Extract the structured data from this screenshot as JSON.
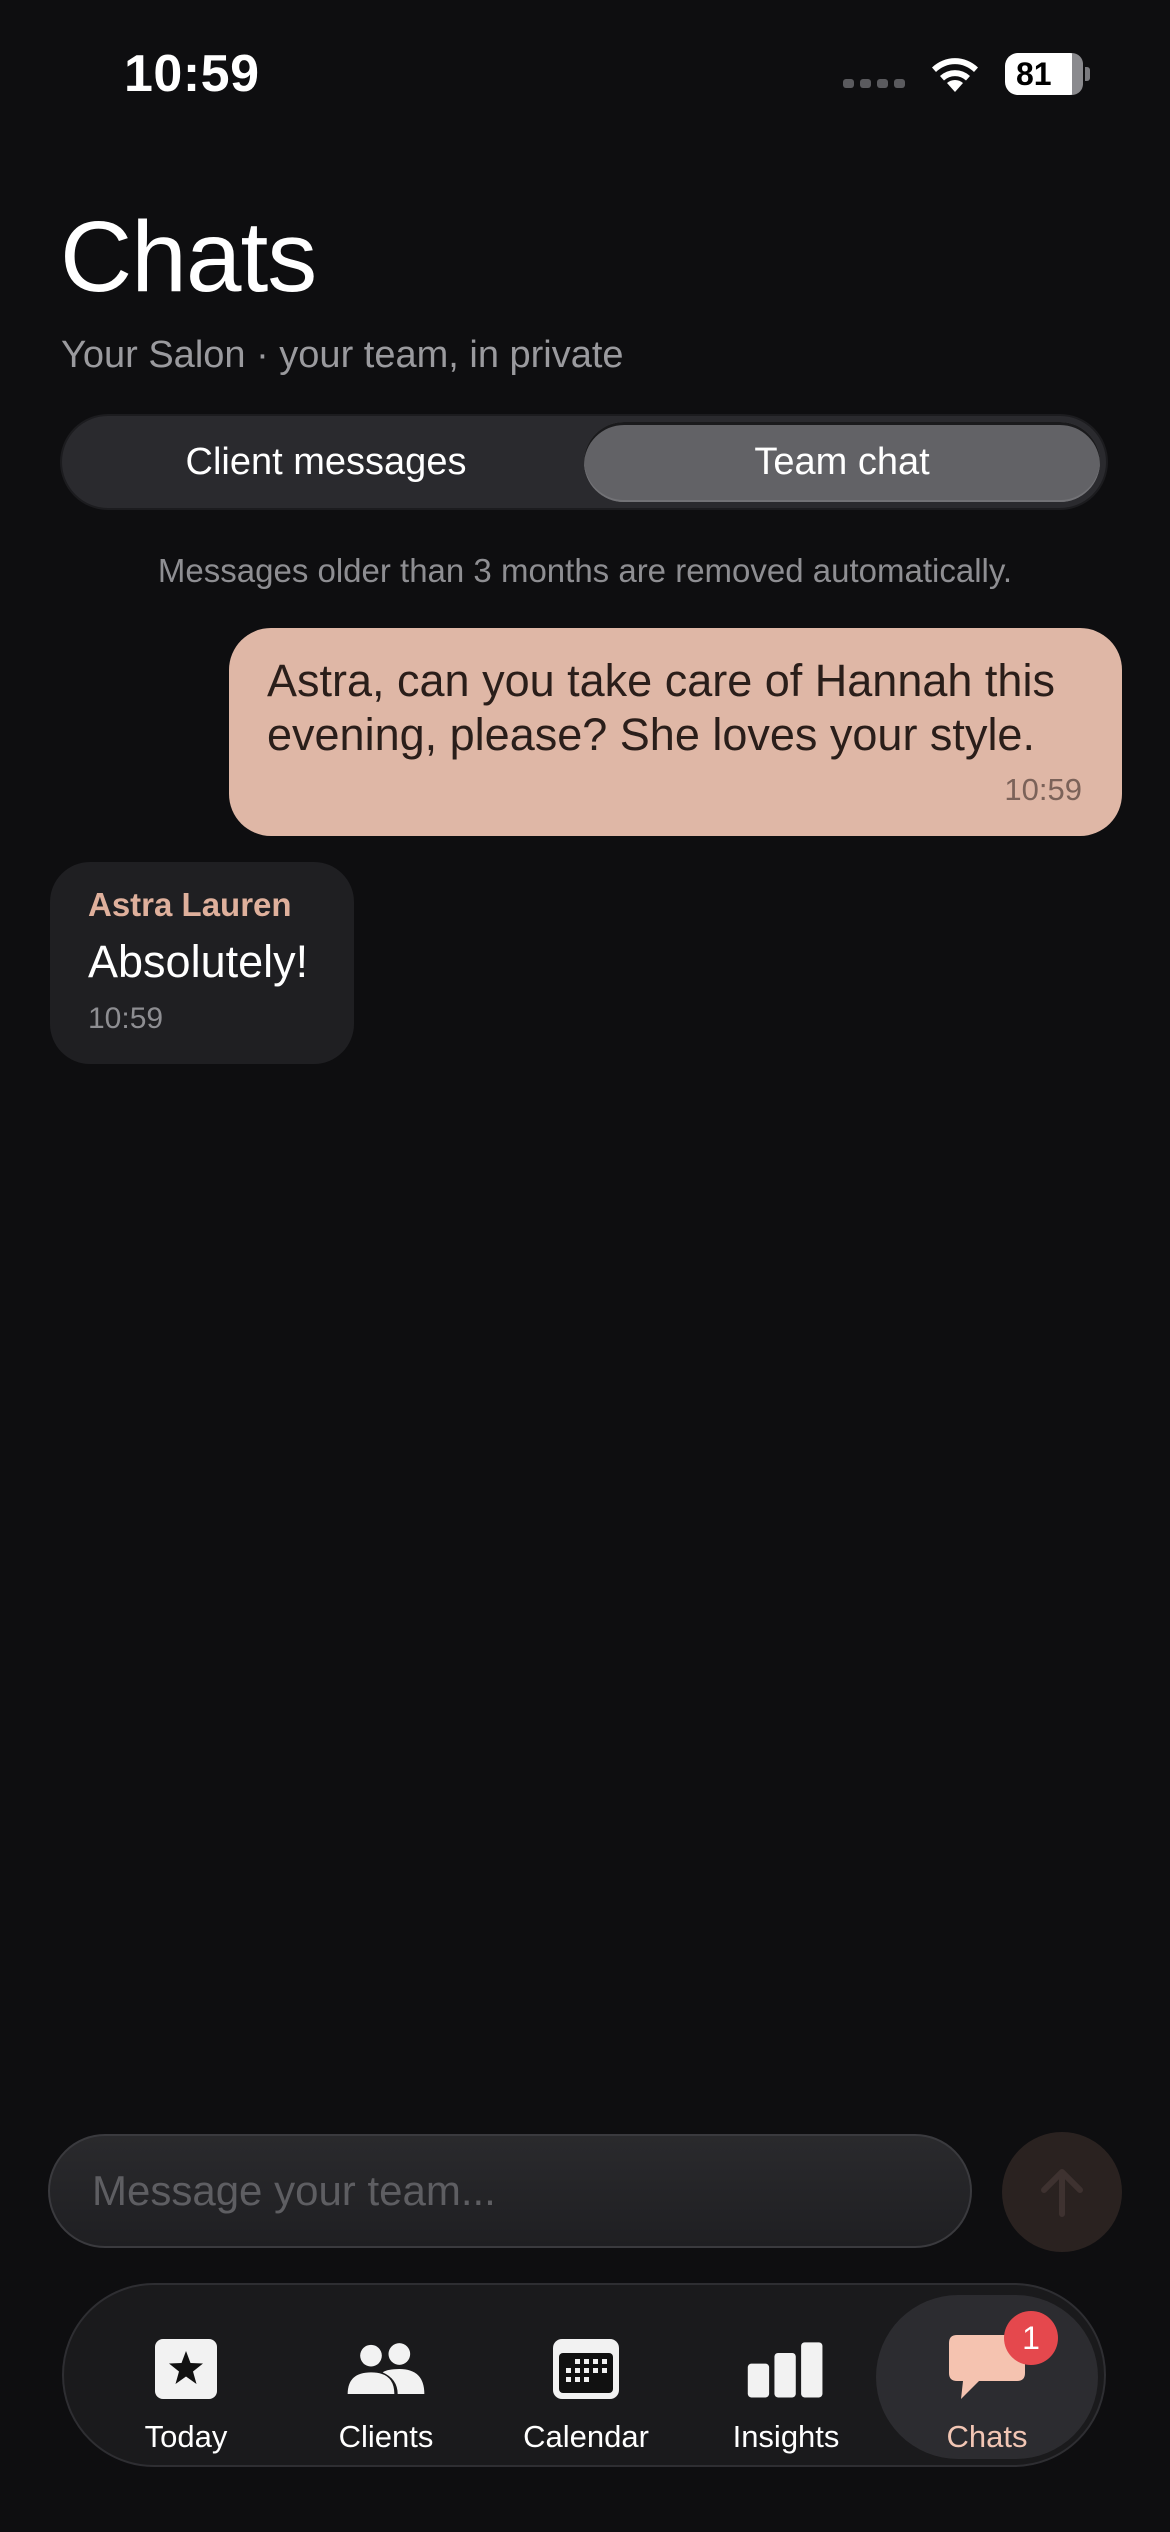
{
  "status_bar": {
    "time": "10:59",
    "battery": "81",
    "icons": [
      "signal-dots-icon",
      "wifi-icon",
      "battery-icon"
    ]
  },
  "header": {
    "title": "Chats",
    "subtitle": "Your Salon · your team, in private"
  },
  "segments": {
    "client_messages": "Client messages",
    "team_chat": "Team chat",
    "selected": "Team chat"
  },
  "retention_note": "Messages older than 3 months are removed automatically.",
  "messages": [
    {
      "direction": "outgoing",
      "text": "Astra, can you take care of Hannah this evening, please? She loves your style.",
      "time": "10:59"
    },
    {
      "direction": "incoming",
      "sender": "Astra Lauren",
      "text": "Absolutely!",
      "time": "10:59"
    }
  ],
  "composer": {
    "placeholder": "Message your team...",
    "value": "",
    "send_icon": "arrow-up-icon"
  },
  "tabbar": {
    "tabs": [
      {
        "label": "Today",
        "icon": "star-icon"
      },
      {
        "label": "Clients",
        "icon": "people-icon"
      },
      {
        "label": "Calendar",
        "icon": "calendar-icon"
      },
      {
        "label": "Insights",
        "icon": "bar-chart-icon"
      },
      {
        "label": "Chats",
        "icon": "chat-bubble-icon",
        "badge": "1"
      }
    ],
    "active": "Chats"
  },
  "colors": {
    "background": "#0e0e10",
    "accent": "#dfb7a6",
    "accent_text": "#f2c6b4",
    "badge": "#e5484d"
  }
}
